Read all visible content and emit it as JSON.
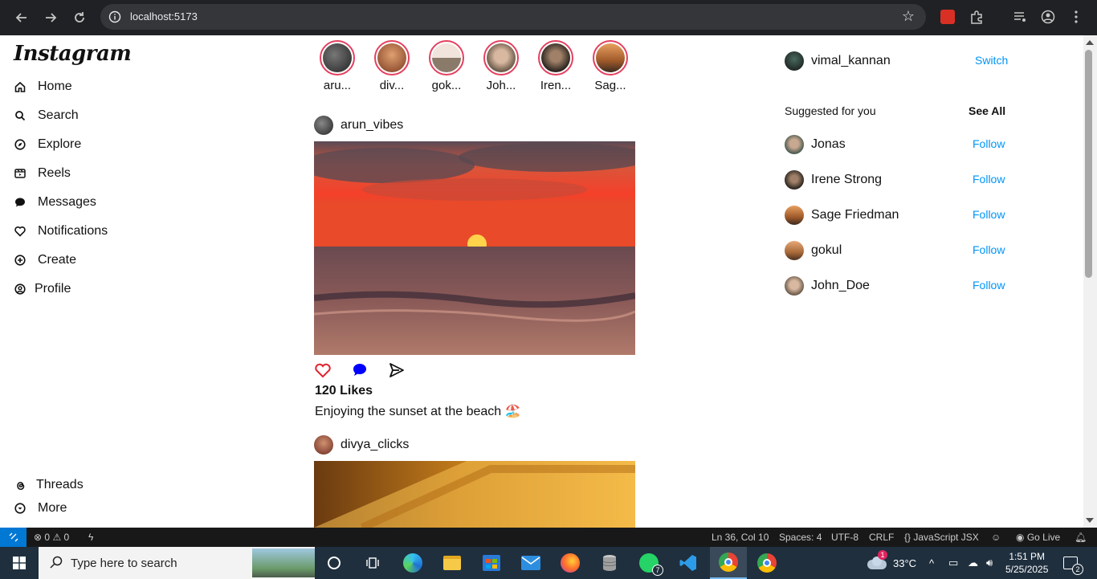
{
  "browser": {
    "url": "localhost:5173"
  },
  "sidebar": {
    "logo": "Instagram",
    "items": [
      {
        "label": "Home",
        "icon": "home-icon"
      },
      {
        "label": "Search",
        "icon": "search-icon"
      },
      {
        "label": "Explore",
        "icon": "compass-icon"
      },
      {
        "label": "Reels",
        "icon": "reels-icon"
      },
      {
        "label": "Messages",
        "icon": "message-icon"
      },
      {
        "label": "Notifications",
        "icon": "heart-icon"
      },
      {
        "label": "Create",
        "icon": "plus-circle-icon"
      },
      {
        "label": "Profile",
        "icon": "profile-icon"
      }
    ],
    "bottom": [
      {
        "label": "Threads",
        "icon": "threads-icon"
      },
      {
        "label": "More",
        "icon": "chevron-circle-icon"
      }
    ]
  },
  "stories": [
    {
      "name": "aru...",
      "color": "#3a3a3a"
    },
    {
      "name": "div...",
      "color": "#b5643c"
    },
    {
      "name": "gok...",
      "color": "#d9c7b8"
    },
    {
      "name": "Joh...",
      "color": "#b89a82"
    },
    {
      "name": "Iren...",
      "color": "#4a3b32"
    },
    {
      "name": "Sag...",
      "color": "#c98a54"
    }
  ],
  "posts": [
    {
      "user": "arun_vibes",
      "likes": "120 Likes",
      "caption": "Enjoying the sunset at the beach 🏖️"
    },
    {
      "user": "divya_clicks"
    }
  ],
  "right": {
    "current_user": "vimal_kannan",
    "switch_label": "Switch",
    "suggested_title": "Suggested for you",
    "see_all": "See All",
    "suggestions": [
      {
        "name": "Jonas",
        "action": "Follow"
      },
      {
        "name": "Irene Strong",
        "action": "Follow"
      },
      {
        "name": "Sage Friedman",
        "action": "Follow"
      },
      {
        "name": "gokul",
        "action": "Follow"
      },
      {
        "name": "John_Doe",
        "action": "Follow"
      }
    ]
  },
  "statusbar": {
    "errors": "0",
    "warnings": "0",
    "position": "Ln 36, Col 10",
    "spaces": "Spaces: 4",
    "encoding": "UTF-8",
    "eol": "CRLF",
    "language": "JavaScript JSX",
    "golive": "Go Live"
  },
  "taskbar": {
    "search_placeholder": "Type here to search",
    "weather": "33°C",
    "weather_badge": "1",
    "time": "1:51 PM",
    "date": "5/25/2025",
    "whatsapp_badge": "7",
    "notif_count": "2"
  }
}
